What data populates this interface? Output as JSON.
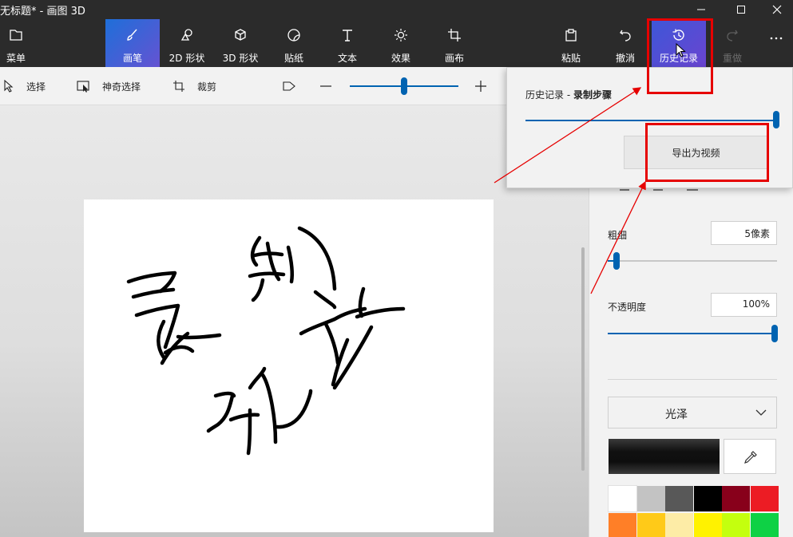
{
  "window": {
    "title": "无标题* - 画图 3D"
  },
  "ribbon": {
    "menu": {
      "label": "菜单",
      "icon": "folder-icon"
    },
    "tools": [
      {
        "key": "brushes",
        "label": "画笔",
        "icon": "brush-icon",
        "active": true
      },
      {
        "key": "shapes2d",
        "label": "2D 形状",
        "icon": "shapes-2d-icon"
      },
      {
        "key": "shapes3d",
        "label": "3D 形状",
        "icon": "cube-icon"
      },
      {
        "key": "stickers",
        "label": "贴纸",
        "icon": "sticker-icon"
      },
      {
        "key": "text",
        "label": "文本",
        "icon": "text-icon"
      },
      {
        "key": "effects",
        "label": "效果",
        "icon": "sun-icon"
      },
      {
        "key": "canvas",
        "label": "画布",
        "icon": "canvas-crop-icon"
      }
    ],
    "actions": [
      {
        "key": "paste",
        "label": "粘贴",
        "icon": "clipboard-icon"
      },
      {
        "key": "undo",
        "label": "撤消",
        "icon": "undo-icon"
      },
      {
        "key": "history",
        "label": "历史记录",
        "icon": "history-icon",
        "active": true
      },
      {
        "key": "redo",
        "label": "重做",
        "icon": "redo-icon",
        "disabled": true
      }
    ],
    "more_icon": "more-icon"
  },
  "toolbar": {
    "select_label": "选择",
    "magic_select_label": "神奇选择",
    "crop_label": "裁剪"
  },
  "history_panel": {
    "title_prefix": "历史记录 - ",
    "title_bold": "录制步骤",
    "slider_value": 1.0,
    "export_label": "导出为视频"
  },
  "brush_panel": {
    "thickness_label": "粗细",
    "thickness_value": "5像素",
    "thickness_slider": 0.05,
    "opacity_label": "不透明度",
    "opacity_value": "100%",
    "opacity_slider": 1.0,
    "finish_value": "光泽",
    "current_color": "#111111",
    "palette": [
      "#ffffff",
      "#c3c3c3",
      "#585858",
      "#000000",
      "#88001b",
      "#ec1c24",
      "#ff7f27",
      "#ffca18",
      "#fdeca6",
      "#fff200",
      "#c4ff0e",
      "#0ed145"
    ]
  },
  "canvas": {
    "handwriting": "录制视频"
  },
  "colors": {
    "accent": "#0063b1",
    "annotation_red": "#e60000",
    "titlebar": "#2b2b2b"
  }
}
